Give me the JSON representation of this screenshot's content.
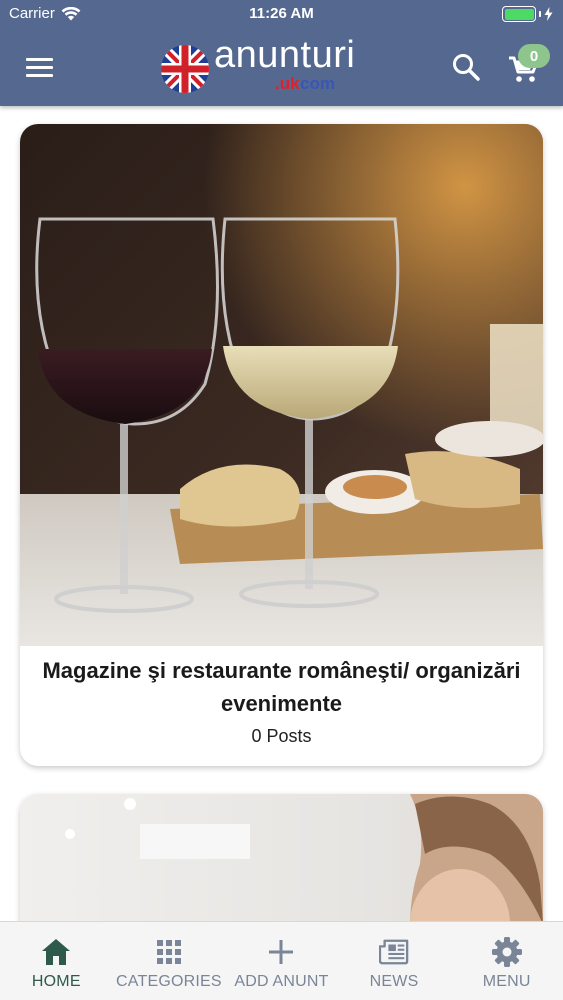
{
  "status_bar": {
    "carrier": "Carrier",
    "time": "11:26 AM"
  },
  "header": {
    "logo_text": "anunturi",
    "logo_sub_red": ".uk",
    "logo_sub_blue": "com",
    "cart_count": "0",
    "icons": {
      "menu": "hamburger-icon",
      "search": "search-icon",
      "cart": "cart-icon"
    }
  },
  "colors": {
    "header_bg": "#55688f",
    "badge_bg": "#8ec58c",
    "active_tab": "#2e5a4c",
    "inactive_tab": "#7a8597"
  },
  "cards": [
    {
      "title": "Magazine şi restaurante româneşti/ organizări evenimente",
      "meta": "0 Posts"
    }
  ],
  "bottom_nav": {
    "items": [
      {
        "label": "HOME",
        "icon": "home-icon",
        "active": true
      },
      {
        "label": "CATEGORIES",
        "icon": "grid-icon",
        "active": false
      },
      {
        "label": "ADD ANUNT",
        "icon": "plus-icon",
        "active": false
      },
      {
        "label": "NEWS",
        "icon": "newspaper-icon",
        "active": false
      },
      {
        "label": "MENU",
        "icon": "gear-icon",
        "active": false
      }
    ]
  }
}
